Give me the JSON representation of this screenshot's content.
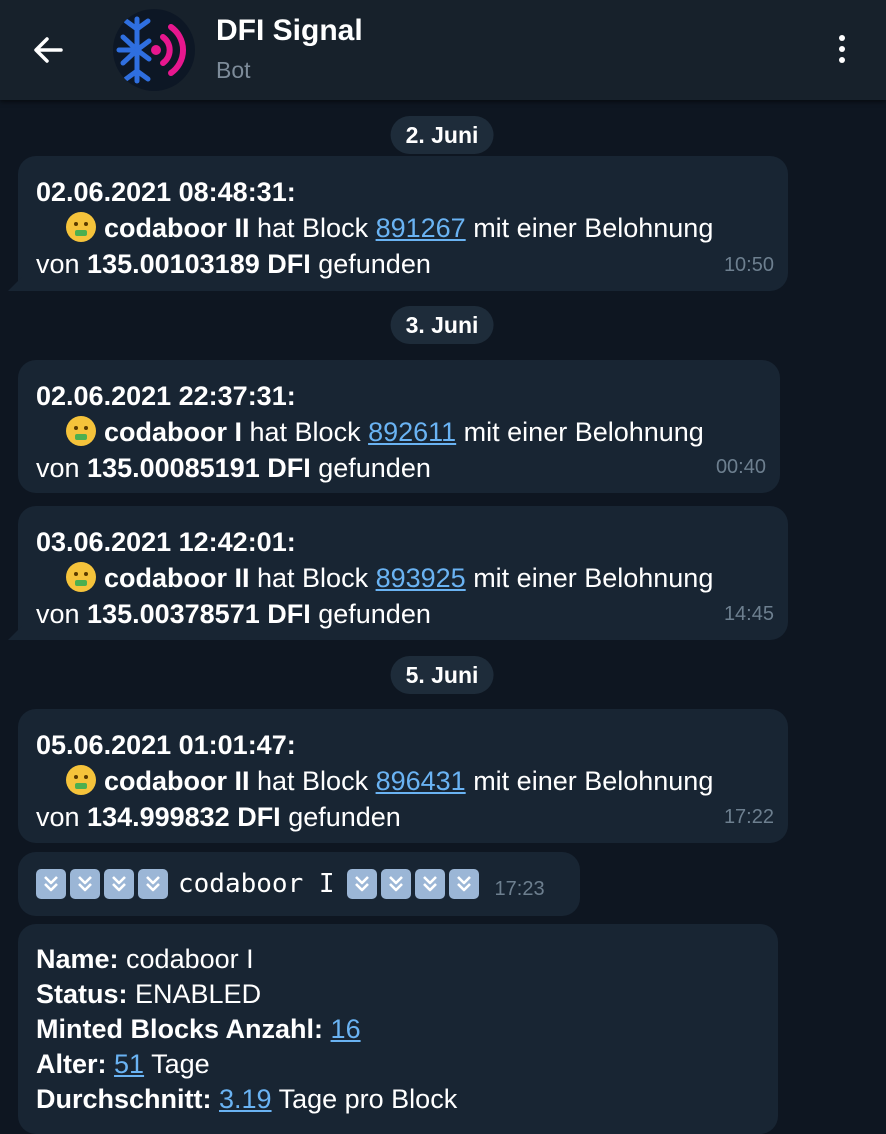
{
  "header": {
    "title": "DFI Signal",
    "subtitle": "Bot",
    "avatar_colors": {
      "left": "#2f6fe0",
      "right": "#e7178e"
    }
  },
  "dates": [
    "2. Juni",
    "3. Juni",
    "5. Juni"
  ],
  "messages": [
    {
      "timestamp": "02.06.2021 08:48:31:",
      "name": "codaboor II",
      "text_block": " hat Block ",
      "block": "891267",
      "text_reward": " mit einer Belohnung",
      "von": "von ",
      "amount": "135.00103189 DFI",
      "found": " gefunden",
      "time": "10:50"
    },
    {
      "timestamp": "02.06.2021 22:37:31:",
      "name": "codaboor I",
      "text_block": " hat Block ",
      "block": "892611",
      "text_reward": " mit einer Belohnung",
      "von": "von ",
      "amount": "135.00085191 DFI",
      "found": " gefunden",
      "time": "00:40"
    },
    {
      "timestamp": "03.06.2021 12:42:01:",
      "name": "codaboor II",
      "text_block": " hat Block ",
      "block": "893925",
      "text_reward": " mit einer Belohnung",
      "von": "von ",
      "amount": "135.00378571 DFI",
      "found": " gefunden",
      "time": "14:45"
    },
    {
      "timestamp": "05.06.2021 01:01:47:",
      "name": "codaboor II",
      "text_block": " hat Block ",
      "block": "896431",
      "text_reward": " mit einer Belohnung",
      "von": "von ",
      "amount": "134.999832 DFI",
      "found": " gefunden",
      "time": "17:22"
    }
  ],
  "separator": {
    "label": "codaboor I",
    "time": "17:23",
    "icon": "double-down-arrow-icon"
  },
  "info": {
    "name_label": "Name:",
    "name_value": " codaboor I",
    "status_label": "Status:",
    "status_value": " ENABLED",
    "minted_label": "Minted Blocks Anzahl:",
    "minted_value": "16",
    "alter_label": "Alter:",
    "alter_value": "51",
    "alter_unit": " Tage",
    "avg_label": "Durchschnitt:",
    "avg_value": "3.19",
    "avg_unit": " Tage pro Block"
  },
  "colors": {
    "background": "#0e1621",
    "header": "#17212b",
    "bubble": "#182533",
    "link": "#6ab3f3",
    "time": "#6d7f8f"
  }
}
